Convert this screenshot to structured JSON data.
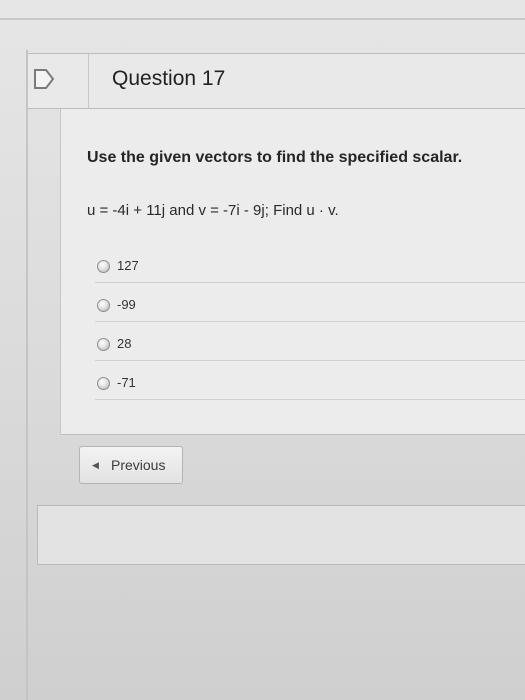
{
  "question": {
    "title": "Question 17",
    "prompt": "Use the given vectors to find the specified scalar.",
    "expression": "u = -4i + 11j and v = -7i - 9j; Find u · v.",
    "choices": [
      {
        "label": "127"
      },
      {
        "label": "-99"
      },
      {
        "label": "28"
      },
      {
        "label": "-71"
      }
    ]
  },
  "navigation": {
    "previous_label": "Previous",
    "previous_icon": "triangle-left-icon"
  },
  "icons": {
    "flag": "flag-outline-icon"
  }
}
